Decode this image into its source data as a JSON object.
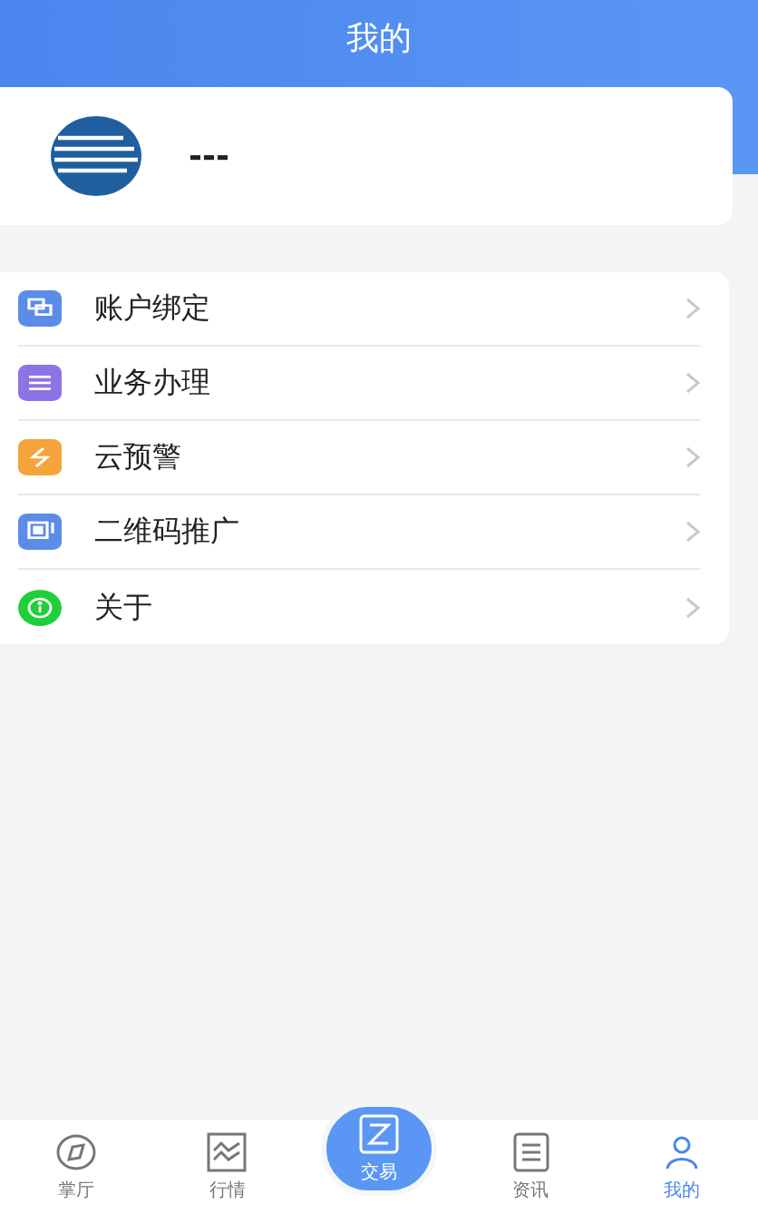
{
  "header": {
    "title": "我的"
  },
  "profile": {
    "name": "---"
  },
  "menu": [
    {
      "label": "账户绑定",
      "kind": "link",
      "color": "#5b8de8"
    },
    {
      "label": "业务办理",
      "kind": "list",
      "color": "#8b74e6"
    },
    {
      "label": "云预警",
      "kind": "bolt",
      "color": "#f4a43a"
    },
    {
      "label": "二维码推广",
      "kind": "qr",
      "color": "#5b8de8"
    },
    {
      "label": "关于",
      "kind": "info",
      "color": "#1fcf3a"
    }
  ],
  "tabs": [
    {
      "label": "掌厅",
      "kind": "compass",
      "selected": false
    },
    {
      "label": "行情",
      "kind": "chart",
      "selected": false
    },
    {
      "label": "交易",
      "kind": "trade",
      "selected": false
    },
    {
      "label": "资讯",
      "kind": "news",
      "selected": false
    },
    {
      "label": "我的",
      "kind": "me",
      "selected": true
    }
  ]
}
